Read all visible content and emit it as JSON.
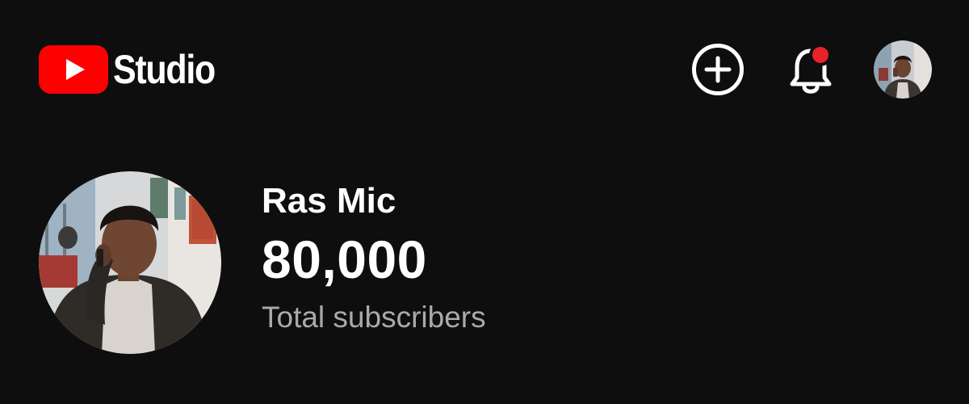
{
  "header": {
    "brand": "Studio",
    "brand_color": "#FF0000",
    "icons": [
      "youtube-logo-icon",
      "create-plus-icon",
      "bell-icon",
      "account-avatar"
    ],
    "notification_dot_color": "#FF0000"
  },
  "channel": {
    "name": "Ras Mic",
    "subscribers": "80,000",
    "subscribers_label": "Total subscribers"
  },
  "colors": {
    "background": "#0E0E0E",
    "text_primary": "#FFFFFF",
    "text_secondary": "#AAAAAA"
  }
}
